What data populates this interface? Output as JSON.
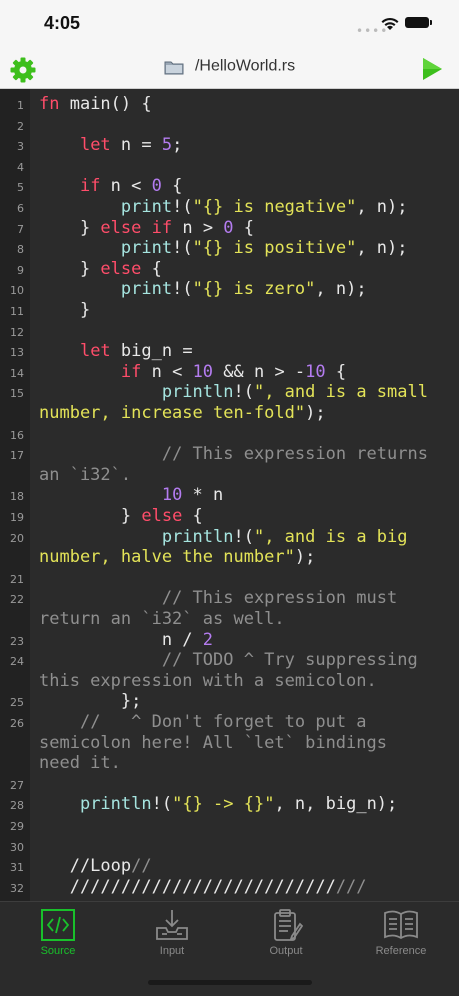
{
  "status": {
    "time": "4:05"
  },
  "nav": {
    "title": "/HelloWorld.rs",
    "settings_icon": "gear-icon",
    "run_icon": "play-icon",
    "folder_icon": "folder-icon",
    "accent_color": "#3dbf1c"
  },
  "editor": {
    "lines": [
      {
        "n": "1",
        "text": "fn main() {"
      },
      {
        "n": "2",
        "text": ""
      },
      {
        "n": "3",
        "text": "    let n = 5;"
      },
      {
        "n": "4",
        "text": ""
      },
      {
        "n": "5",
        "text": "    if n < 0 {"
      },
      {
        "n": "6",
        "text": "        print!(\"{} is negative\", n);"
      },
      {
        "n": "7",
        "text": "    } else if n > 0 {"
      },
      {
        "n": "8",
        "text": "        print!(\"{} is positive\", n);"
      },
      {
        "n": "9",
        "text": "    } else {"
      },
      {
        "n": "10",
        "text": "        print!(\"{} is zero\", n);"
      },
      {
        "n": "11",
        "text": "    }"
      },
      {
        "n": "12",
        "text": ""
      },
      {
        "n": "13",
        "text": "    let big_n ="
      },
      {
        "n": "14",
        "text": "        if n < 10 && n > -10 {"
      },
      {
        "n": "15",
        "text": "            println!(\", and is a small\nnumber, increase ten-fold\");"
      },
      {
        "n": "16",
        "text": ""
      },
      {
        "n": "17",
        "text": "            // This expression returns\nan `i32`."
      },
      {
        "n": "18",
        "text": "            10 * n"
      },
      {
        "n": "19",
        "text": "        } else {"
      },
      {
        "n": "20",
        "text": "            println!(\", and is a big\nnumber, halve the number\");"
      },
      {
        "n": "21",
        "text": ""
      },
      {
        "n": "22",
        "text": "            // This expression must\nreturn an `i32` as well."
      },
      {
        "n": "23",
        "text": "            n / 2"
      },
      {
        "n": "24",
        "text": "            // TODO ^ Try suppressing\nthis expression with a semicolon."
      },
      {
        "n": "25",
        "text": "        };"
      },
      {
        "n": "26",
        "text": "    //   ^ Don't forget to put a\nsemicolon here! All `let` bindings\nneed it."
      },
      {
        "n": "27",
        "text": ""
      },
      {
        "n": "28",
        "text": "    println!(\"{} -> {}\", n, big_n);"
      },
      {
        "n": "29",
        "text": ""
      },
      {
        "n": "30",
        "text": ""
      },
      {
        "n": "31",
        "text": "   //Loop//"
      },
      {
        "n": "32",
        "text": "   ///////////////////////////"
      }
    ]
  },
  "tabs": [
    {
      "label": "Source",
      "icon": "code-icon",
      "active": true
    },
    {
      "label": "Input",
      "icon": "download-tray-icon",
      "active": false
    },
    {
      "label": "Output",
      "icon": "clipboard-icon",
      "active": false
    },
    {
      "label": "Reference",
      "icon": "book-icon",
      "active": false
    }
  ]
}
